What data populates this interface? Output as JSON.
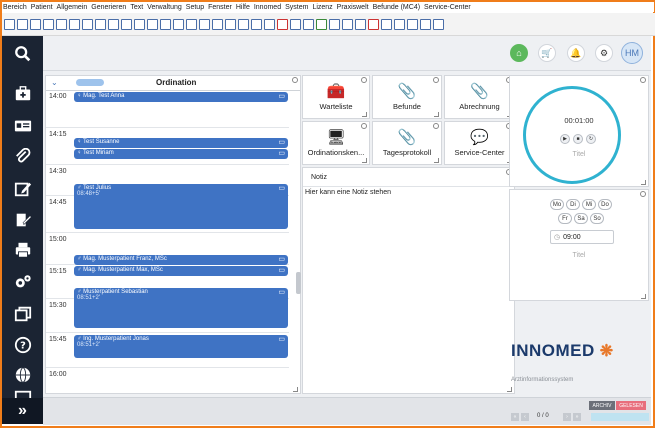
{
  "menu": [
    "Bereich",
    "Patient",
    "Allgemein",
    "Generieren",
    "Text",
    "Verwaltung",
    "Setup",
    "Fenster",
    "Hilfe",
    "Innomed",
    "System",
    "Lizenz",
    "Praxiswelt",
    "Befunde (MC4)",
    "Service-Center"
  ],
  "header": {
    "avatar_initials": "HM"
  },
  "calendar": {
    "title": "Ordination",
    "times": [
      "14:00",
      "14:15",
      "14:30",
      "14:45",
      "15:00",
      "15:15",
      "15:30",
      "15:45",
      "16:00"
    ],
    "appointments": [
      {
        "name": "♀ Mag. Test Anna",
        "sub": ""
      },
      {
        "name": "♀ Test Susanne",
        "sub": ""
      },
      {
        "name": "♀ Test Miriam",
        "sub": ""
      },
      {
        "name": "♂ Test Julius",
        "sub": "08:48+5'"
      },
      {
        "name": "♂ Mag. Musterpatient Franz, MSc",
        "sub": ""
      },
      {
        "name": "♂ Mag. Musterpatient Max, MSc",
        "sub": ""
      },
      {
        "name": "♂ Musterpatient Sebastian",
        "sub": "08:51+2'"
      },
      {
        "name": "♂ Ing. Musterpatient Jonas",
        "sub": "08:51+2'"
      }
    ]
  },
  "tiles": [
    "Warteliste",
    "Befunde",
    "Abrechnung",
    "Ordinationsken...",
    "Tagesprotokoll",
    "Service-Center"
  ],
  "notes": {
    "tab": "Notiz",
    "placeholder": "Hier kann eine Notiz stehen"
  },
  "timer": {
    "value": "00:01:00",
    "title": "Titel"
  },
  "alarm": {
    "days": [
      "Mo",
      "Di",
      "Mi",
      "Do",
      "Fr",
      "Sa",
      "So"
    ],
    "time": "09:00",
    "title": "Titel"
  },
  "logo": {
    "name": "INNOMED",
    "subtitle": "Arztinformationssystem"
  },
  "footer": {
    "archiv": "ARCHIV",
    "gelesen": "GELESEN",
    "pagination": "0 / 0"
  }
}
